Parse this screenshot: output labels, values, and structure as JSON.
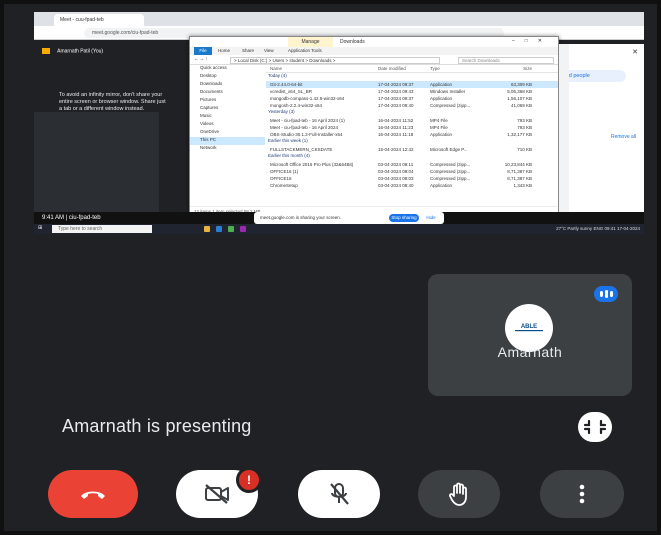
{
  "browser": {
    "tab_title": "Meet - cuu-fpad-teb",
    "url": "meet.google.com/ciu-fpad-teb"
  },
  "meet_header": {
    "presenter_label": "Amarnath Patil (You)"
  },
  "infinity_warning": "To avoid an infinity mirror, don't share your entire screen or browser window. Share just a tab or a different window instead.",
  "people_panel": {
    "add_people_label": "Add people",
    "remove_all_label": "Remove all",
    "row_counts": [
      "2",
      "^"
    ]
  },
  "explorer": {
    "manage_tab": "Manage",
    "window_title": "Downloads",
    "ribbon_tabs": [
      "File",
      "Home",
      "Share",
      "View",
      "Application Tools"
    ],
    "path": "> Local Disk (C:) > Users > student > Downloads >",
    "search_placeholder": "Search Downloads",
    "columns": [
      "Name",
      "Date modified",
      "Type",
      "Size"
    ],
    "nav_items": [
      {
        "label": "Quick access",
        "selected": false
      },
      {
        "label": "Desktop",
        "selected": false
      },
      {
        "label": "Downloads",
        "selected": false
      },
      {
        "label": "Documents",
        "selected": false
      },
      {
        "label": "Pictures",
        "selected": false
      },
      {
        "label": "Captures",
        "selected": false
      },
      {
        "label": "Music",
        "selected": false
      },
      {
        "label": "Videos",
        "selected": false
      },
      {
        "label": "OneDrive",
        "selected": false
      },
      {
        "label": "This PC",
        "selected": true
      },
      {
        "label": "Network",
        "selected": false
      }
    ],
    "groups": [
      {
        "name": "Today (4)",
        "files": [
          {
            "name": "Git-2.44.0-64-bit",
            "date": "17-04-2024 09:37",
            "type": "Application",
            "size": "63,309 KB",
            "selected": true
          },
          {
            "name": "vcredist_x64_SL_BR",
            "date": "17-04-2024 09:43",
            "type": "Windows Installer",
            "size": "5,06,368 KB",
            "selected": false
          },
          {
            "name": "mongodb-compass-1.42.5-win32-x64",
            "date": "17-04-2024 09:37",
            "type": "Application",
            "size": "1,56,107 KB",
            "selected": false
          },
          {
            "name": "mongosh-2.2.4-win32-x64",
            "date": "17-04-2024 09:40",
            "type": "Compressed (zipp...",
            "size": "41,069 KB",
            "selected": false
          }
        ]
      },
      {
        "name": "Yesterday (3)",
        "files": [
          {
            "name": "Meet - ciu-fpad-teb - 16 April 2024 (1)",
            "date": "16-04-2024 11:52",
            "type": "MP4 File",
            "size": "793 KB",
            "selected": false
          },
          {
            "name": "Meet - ciu-fpad-teb - 16 April 2024",
            "date": "16-04-2024 11:23",
            "type": "MP4 File",
            "size": "793 KB",
            "selected": false
          },
          {
            "name": "OBS-Studio-30.1.2-Full-Installer-x64",
            "date": "16-04-2024 11:18",
            "type": "Application",
            "size": "1,32,177 KB",
            "selected": false
          }
        ]
      },
      {
        "name": "Earlier this week (1)",
        "files": [
          {
            "name": "FULLSTACKMERN_CKSDATE",
            "date": "15-04-2024 12:42",
            "type": "Microsoft Edge P...",
            "size": "710 KB",
            "selected": false
          }
        ]
      },
      {
        "name": "Earlier this month (4)",
        "files": [
          {
            "name": "Microsoft Office 2016 Pro Plus (32&64Bit)",
            "date": "03-04-2024 08:11",
            "type": "Compressed (zipp...",
            "size": "10,23,844 KB",
            "selected": false
          },
          {
            "name": "OFFICE16 (1)",
            "date": "03-04-2024 08:04",
            "type": "Compressed (zipp...",
            "size": "8,71,387 KB",
            "selected": false
          },
          {
            "name": "OFFICE16",
            "date": "03-04-2024 08:03",
            "type": "Compressed (zipp...",
            "size": "8,71,387 KB",
            "selected": false
          },
          {
            "name": "ChromeSetup",
            "date": "03-04-2024 08:40",
            "type": "Application",
            "size": "1,343 KB",
            "selected": false
          }
        ]
      }
    ],
    "status": "12 items    1 item selected  58.2 MB"
  },
  "share_bar": {
    "message": "meet.google.com is sharing your screen.",
    "stop_label": "Stop sharing",
    "hide_label": "Hide"
  },
  "mobile_status": {
    "time_meeting": "9:41 AM  |  ciu-fpad-teb"
  },
  "taskbar": {
    "search_placeholder": "Type here to search",
    "weather": "27°C  Partly sunny",
    "tray": "ENG  09:41  17-04-2024"
  },
  "self_view": {
    "name": "Amarnath",
    "logo_text": "ABLE"
  },
  "presenting_text": "Amarnath is presenting",
  "controls": {
    "camera_badge": "!"
  },
  "colors": {
    "end_call": "#ea4335",
    "meet_bg": "#202124",
    "tile_bg": "#3c4043",
    "accent_blue": "#1a73e8"
  }
}
